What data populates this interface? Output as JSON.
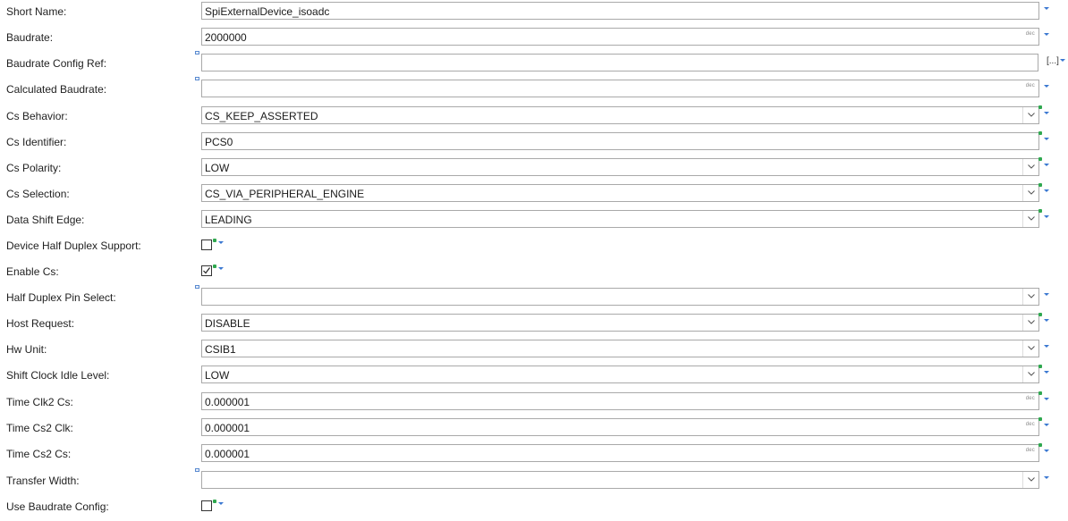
{
  "fields": [
    {
      "label": "Short Name:",
      "kind": "text",
      "value": "SpiExternalDevice_isoadc",
      "dec": false,
      "star": false,
      "mark": false
    },
    {
      "label": "Baudrate:",
      "kind": "text",
      "value": "2000000",
      "dec": true,
      "dec_label": "dec",
      "star": false,
      "mark": false
    },
    {
      "label": "Baudrate Config Ref:",
      "kind": "ref",
      "value": "",
      "browse_label": "[...]",
      "star": false,
      "mark": true
    },
    {
      "label": "Calculated Baudrate:",
      "kind": "text",
      "value": "",
      "dec": true,
      "dec_label": "dec",
      "star": false,
      "mark": true
    },
    {
      "label": "Cs Behavior:",
      "kind": "combo",
      "value": "CS_KEEP_ASSERTED",
      "star": true,
      "mark": false
    },
    {
      "label": "Cs Identifier:",
      "kind": "text",
      "value": "PCS0",
      "dec": false,
      "star": true,
      "mark": false
    },
    {
      "label": "Cs Polarity:",
      "kind": "combo",
      "value": "LOW",
      "star": true,
      "mark": false
    },
    {
      "label": "Cs Selection:",
      "kind": "combo",
      "value": "CS_VIA_PERIPHERAL_ENGINE",
      "star": true,
      "mark": false
    },
    {
      "label": "Data Shift Edge:",
      "kind": "combo",
      "value": "LEADING",
      "star": true,
      "mark": false
    },
    {
      "label": "Device Half Duplex Support:",
      "kind": "checkbox",
      "checked": false,
      "star": true
    },
    {
      "label": "Enable Cs:",
      "kind": "checkbox",
      "checked": true,
      "star": true
    },
    {
      "label": "Half Duplex Pin Select:",
      "kind": "combo",
      "value": "",
      "star": false,
      "mark": true
    },
    {
      "label": "Host Request:",
      "kind": "combo",
      "value": "DISABLE",
      "star": true,
      "mark": false
    },
    {
      "label": "Hw Unit:",
      "kind": "combo",
      "value": "CSIB1",
      "star": false,
      "mark": false
    },
    {
      "label": "Shift Clock Idle Level:",
      "kind": "combo",
      "value": "LOW",
      "star": true,
      "mark": false
    },
    {
      "label": "Time Clk2 Cs:",
      "kind": "text",
      "value": "0.000001",
      "dec": true,
      "dec_label": "dec",
      "star": true,
      "mark": false
    },
    {
      "label": "Time Cs2 Clk:",
      "kind": "text",
      "value": "0.000001",
      "dec": true,
      "dec_label": "dec",
      "star": true,
      "mark": false
    },
    {
      "label": "Time Cs2 Cs:",
      "kind": "text",
      "value": "0.000001",
      "dec": true,
      "dec_label": "dec",
      "star": true,
      "mark": false
    },
    {
      "label": "Transfer Width:",
      "kind": "combo",
      "value": "",
      "star": false,
      "mark": true
    },
    {
      "label": "Use Baudrate Config:",
      "kind": "checkbox",
      "checked": false,
      "star": true
    }
  ],
  "colors": {
    "accent": "#3b78d1",
    "star": "#2fa84f",
    "border": "#a9a9a9"
  }
}
